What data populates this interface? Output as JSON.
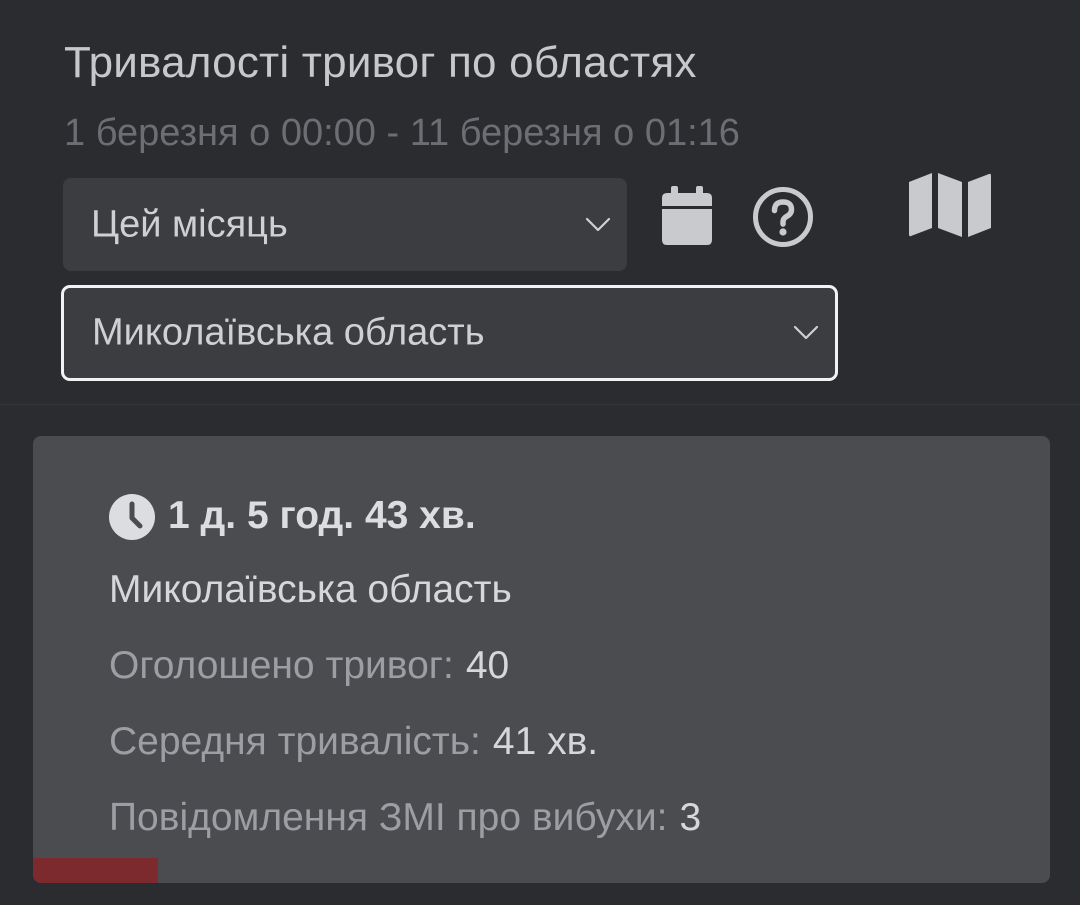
{
  "header": {
    "title": "Тривалості тривог по областях",
    "subtitle": "1 березня о 00:00 - 11 березня о 01:16"
  },
  "filters": {
    "period": {
      "selected": "Цей місяць",
      "icon": "chevron-down-icon"
    },
    "region": {
      "selected": "Миколаївська область",
      "icon": "chevron-down-icon"
    }
  },
  "toolbar": {
    "calendar_icon": "calendar-icon",
    "help_icon": "help-icon",
    "map_icon": "map-icon"
  },
  "result_card": {
    "duration_icon": "clock-icon",
    "duration": "1 д. 5 год. 43 хв.",
    "region": "Миколаївська область",
    "alerts_label": "Оголошено тривог:",
    "alerts_value": "40",
    "avg_label": "Середня тривалість:",
    "avg_value": "41 хв.",
    "media_label": "Повідомлення ЗМІ про вибухи:",
    "media_value": "3",
    "share_fraction": 0.123,
    "bar_color": "#7c2a2d"
  },
  "colors": {
    "background": "#2b2c2f",
    "card": "#4b4c50",
    "control": "#3c3d41",
    "text": "#d6d7da",
    "muted": "#9c9ea3"
  }
}
